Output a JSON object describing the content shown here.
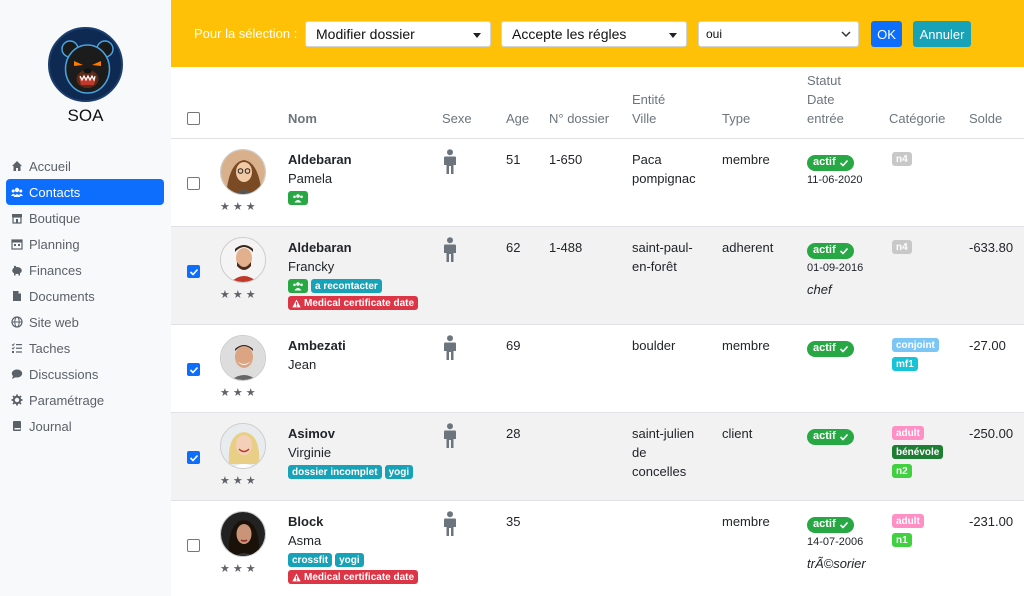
{
  "brand": "SOA",
  "sidebar": {
    "items": [
      {
        "label": "Accueil",
        "icon": "home-icon"
      },
      {
        "label": "Contacts",
        "icon": "users-icon",
        "active": true
      },
      {
        "label": "Boutique",
        "icon": "store-icon"
      },
      {
        "label": "Planning",
        "icon": "calendar-icon"
      },
      {
        "label": "Finances",
        "icon": "piggy-bank-icon"
      },
      {
        "label": "Documents",
        "icon": "file-icon"
      },
      {
        "label": "Site web",
        "icon": "globe-icon"
      },
      {
        "label": "Taches",
        "icon": "tasks-icon"
      },
      {
        "label": "Discussions",
        "icon": "comment-icon"
      },
      {
        "label": "Paramétrage",
        "icon": "gear-icon"
      },
      {
        "label": "Journal",
        "icon": "book-icon"
      }
    ]
  },
  "toolbar": {
    "label": "Pour la sélection :",
    "action_select": "Modifier dossier",
    "field_select": "Accepte les régles",
    "value_select": "oui",
    "ok_label": "OK",
    "cancel_label": "Annuler",
    "colors": {
      "bar": "#ffc107",
      "ok": "#0d6efd",
      "cancel": "#17a2b8"
    }
  },
  "table": {
    "headers": {
      "nom": "Nom",
      "sexe": "Sexe",
      "age": "Age",
      "dossier": "N° dossier",
      "entite_l1": "Entité",
      "entite_l2": "Ville",
      "type": "Type",
      "statut_l1": "Statut",
      "statut_l2": "Date",
      "statut_l3": "entrée",
      "categorie": "Catégorie",
      "solde": "Solde"
    },
    "rows": [
      {
        "checked": false,
        "last": "Aldebaran",
        "first": "Pamela",
        "stars": "★★★",
        "age": "51",
        "dossier": "1-650",
        "city_l1": "Paca",
        "city_l2": "pompignac",
        "city_l3": "",
        "type": "membre",
        "status": "actif",
        "date": "11-06-2020",
        "role": "",
        "categories": [
          "n4"
        ],
        "solde": "",
        "badges": [
          [
            {
              "text": "",
              "icon": "group-icon",
              "color": "green"
            }
          ]
        ]
      },
      {
        "checked": true,
        "last": "Aldebaran",
        "first": "Francky",
        "stars": "★★★",
        "age": "62",
        "dossier": "1-488",
        "city_l1": "saint-paul-",
        "city_l2": "en-forêt",
        "city_l3": "",
        "type": "adherent",
        "status": "actif",
        "date": "01-09-2016",
        "role": "chef",
        "categories": [
          "n4"
        ],
        "solde": "-633.80",
        "badges": [
          [
            {
              "text": "",
              "icon": "group-icon",
              "color": "green"
            },
            {
              "text": "a recontacter",
              "color": "teal"
            }
          ],
          [
            {
              "text": "Medical certificate date",
              "icon": "warning-icon",
              "color": "red"
            }
          ]
        ]
      },
      {
        "checked": true,
        "last": "Ambezati",
        "first": "Jean",
        "stars": "★★★",
        "age": "69",
        "dossier": "",
        "city_l1": "boulder",
        "city_l2": "",
        "city_l3": "",
        "type": "membre",
        "status": "actif",
        "date": "",
        "role": "",
        "categories": [
          "conjoint",
          "mf1"
        ],
        "solde": "-27.00",
        "badges": []
      },
      {
        "checked": true,
        "last": "Asimov",
        "first": "Virginie",
        "stars": "★★★",
        "age": "28",
        "dossier": "",
        "city_l1": "saint-julien",
        "city_l2": "de",
        "city_l3": "concelles",
        "type": "client",
        "status": "actif",
        "date": "",
        "role": "",
        "categories": [
          "adult",
          "bénévole",
          "n2"
        ],
        "solde": "-250.00",
        "badges": [
          [
            {
              "text": "dossier incomplet",
              "color": "teal"
            },
            {
              "text": "yogi",
              "color": "teal"
            }
          ]
        ]
      },
      {
        "checked": false,
        "last": "Block",
        "first": "Asma",
        "stars": "★★★",
        "age": "35",
        "dossier": "",
        "city_l1": "",
        "city_l2": "",
        "city_l3": "",
        "type": "membre",
        "status": "actif",
        "date": "14-07-2006",
        "role": "trÃ©sorier",
        "categories": [
          "adult",
          "n1"
        ],
        "solde": "-231.00",
        "badges": [
          [
            {
              "text": "crossfit",
              "color": "teal"
            },
            {
              "text": "yogi",
              "color": "teal"
            }
          ],
          [
            {
              "text": "Medical certificate date",
              "icon": "warning-icon",
              "color": "red"
            }
          ]
        ]
      }
    ]
  }
}
